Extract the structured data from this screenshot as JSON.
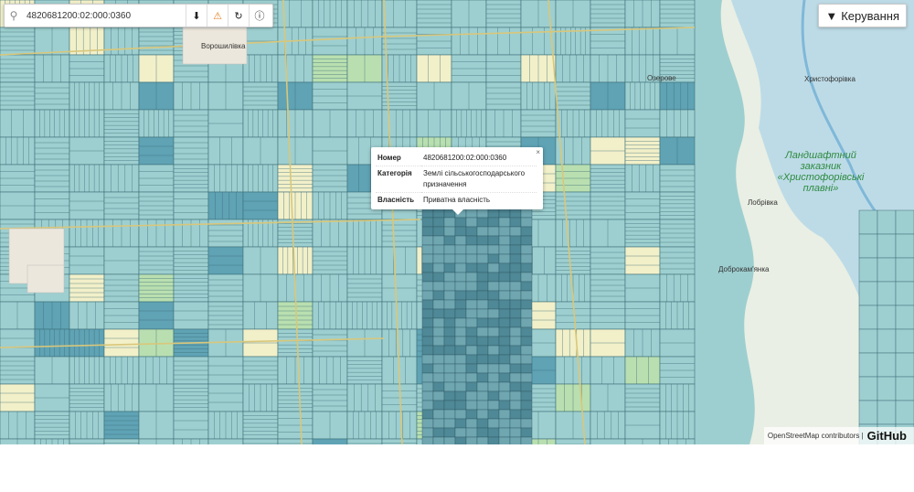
{
  "search": {
    "value": "4820681200:02:000:0360"
  },
  "toolbar": {
    "download_icon": "download-icon",
    "warning_icon": "warning-icon",
    "refresh_icon": "refresh-icon",
    "info_icon": "info-icon"
  },
  "manage": {
    "label": "Керування",
    "icon": "filter-icon"
  },
  "popup": {
    "rows": [
      {
        "key": "Номер",
        "value": "4820681200:02:000:0360"
      },
      {
        "key": "Категорія",
        "value": "Землі сільськогосподарського призначення"
      },
      {
        "key": "Власність",
        "value": "Приватна власність"
      }
    ],
    "close": "×"
  },
  "map": {
    "places": [
      "Христофорівка",
      "Лобрівка",
      "Доброкам'янка",
      "Ворошилівка",
      "Озерове"
    ],
    "reserve": "Ландшафтний заказник «Христофорівські плавні»",
    "colors": {
      "parcel": "#9ecfd0",
      "parcel_dark": "#5fa3b5",
      "water": "#a9d3e8",
      "field": "#f2f0c9",
      "wood": "#b9dfb0"
    }
  },
  "attribution": {
    "osm": "OpenStreetMap contributors |",
    "github": "GitHub"
  }
}
